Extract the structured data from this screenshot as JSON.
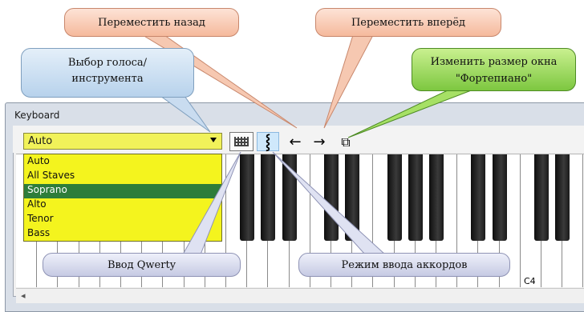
{
  "window": {
    "title": "Keyboard"
  },
  "voice_selector": {
    "value": "Auto",
    "options": [
      "Auto",
      "All Staves",
      "Soprano",
      "Alto",
      "Tenor",
      "Bass"
    ],
    "highlighted": "Soprano"
  },
  "keyboard": {
    "middle_c_label": "C4"
  },
  "callouts": {
    "voice": "Выбор голоса/инструмента",
    "back": "Переместить назад",
    "forward": "Переместить вперёд",
    "resize": "Изменить размер окна \"Фортепиано\"",
    "qwerty": "Ввод Qwerty",
    "chord": "Режим ввода аккордов"
  },
  "icons": {
    "qwerty": "keyboard-grid-icon",
    "chord": "chord-mode-icon",
    "back": "arrow-left-icon",
    "forward": "arrow-right-icon",
    "resize": "resize-window-icon",
    "dropdown": "chevron-down-icon",
    "scroll_left": "scroll-left-icon"
  },
  "colors": {
    "voice_list_bg": "#f4f41e",
    "voice_selected_bg": "#2e7d3a",
    "callout_peach": "#f5b99c",
    "callout_blue": "#b7d2ec",
    "callout_green": "#7dc740",
    "callout_lilac": "#c6cae3"
  }
}
